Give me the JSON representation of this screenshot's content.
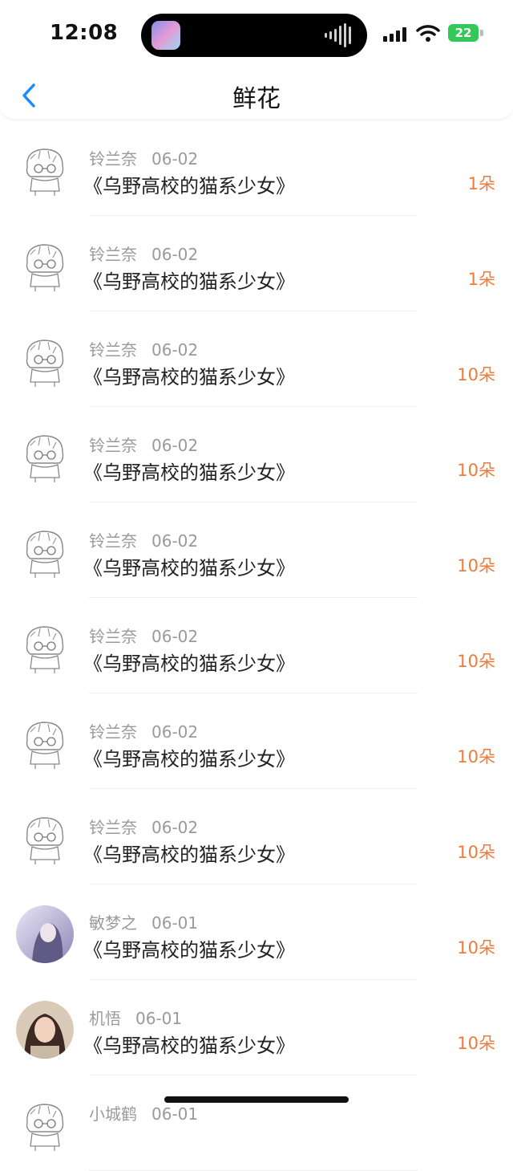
{
  "status": {
    "time": "12:08",
    "battery": "22"
  },
  "nav": {
    "title": "鲜花"
  },
  "records": [
    {
      "user": "铃兰奈",
      "date": "06-02",
      "book": "《乌野高校的猫系少女》",
      "amount": "1朵",
      "avatar": "sketch-avatar"
    },
    {
      "user": "铃兰奈",
      "date": "06-02",
      "book": "《乌野高校的猫系少女》",
      "amount": "1朵",
      "avatar": "sketch-avatar"
    },
    {
      "user": "铃兰奈",
      "date": "06-02",
      "book": "《乌野高校的猫系少女》",
      "amount": "10朵",
      "avatar": "sketch-avatar"
    },
    {
      "user": "铃兰奈",
      "date": "06-02",
      "book": "《乌野高校的猫系少女》",
      "amount": "10朵",
      "avatar": "sketch-avatar"
    },
    {
      "user": "铃兰奈",
      "date": "06-02",
      "book": "《乌野高校的猫系少女》",
      "amount": "10朵",
      "avatar": "sketch-avatar"
    },
    {
      "user": "铃兰奈",
      "date": "06-02",
      "book": "《乌野高校的猫系少女》",
      "amount": "10朵",
      "avatar": "sketch-avatar"
    },
    {
      "user": "铃兰奈",
      "date": "06-02",
      "book": "《乌野高校的猫系少女》",
      "amount": "10朵",
      "avatar": "sketch-avatar"
    },
    {
      "user": "铃兰奈",
      "date": "06-02",
      "book": "《乌野高校的猫系少女》",
      "amount": "10朵",
      "avatar": "sketch-avatar"
    },
    {
      "user": "敏梦之",
      "date": "06-01",
      "book": "《乌野高校的猫系少女》",
      "amount": "10朵",
      "avatar": "anime-girl-avatar"
    },
    {
      "user": "机悟",
      "date": "06-01",
      "book": "《乌野高校的猫系少女》",
      "amount": "10朵",
      "avatar": "photo-girl-avatar"
    },
    {
      "user": "小城鹤",
      "date": "06-01",
      "book": "",
      "amount": "",
      "avatar": "sketch-avatar"
    }
  ],
  "colors": {
    "accent": "#1a8cff",
    "amount": "#ef7b3b",
    "meta": "#9a9a9a"
  }
}
